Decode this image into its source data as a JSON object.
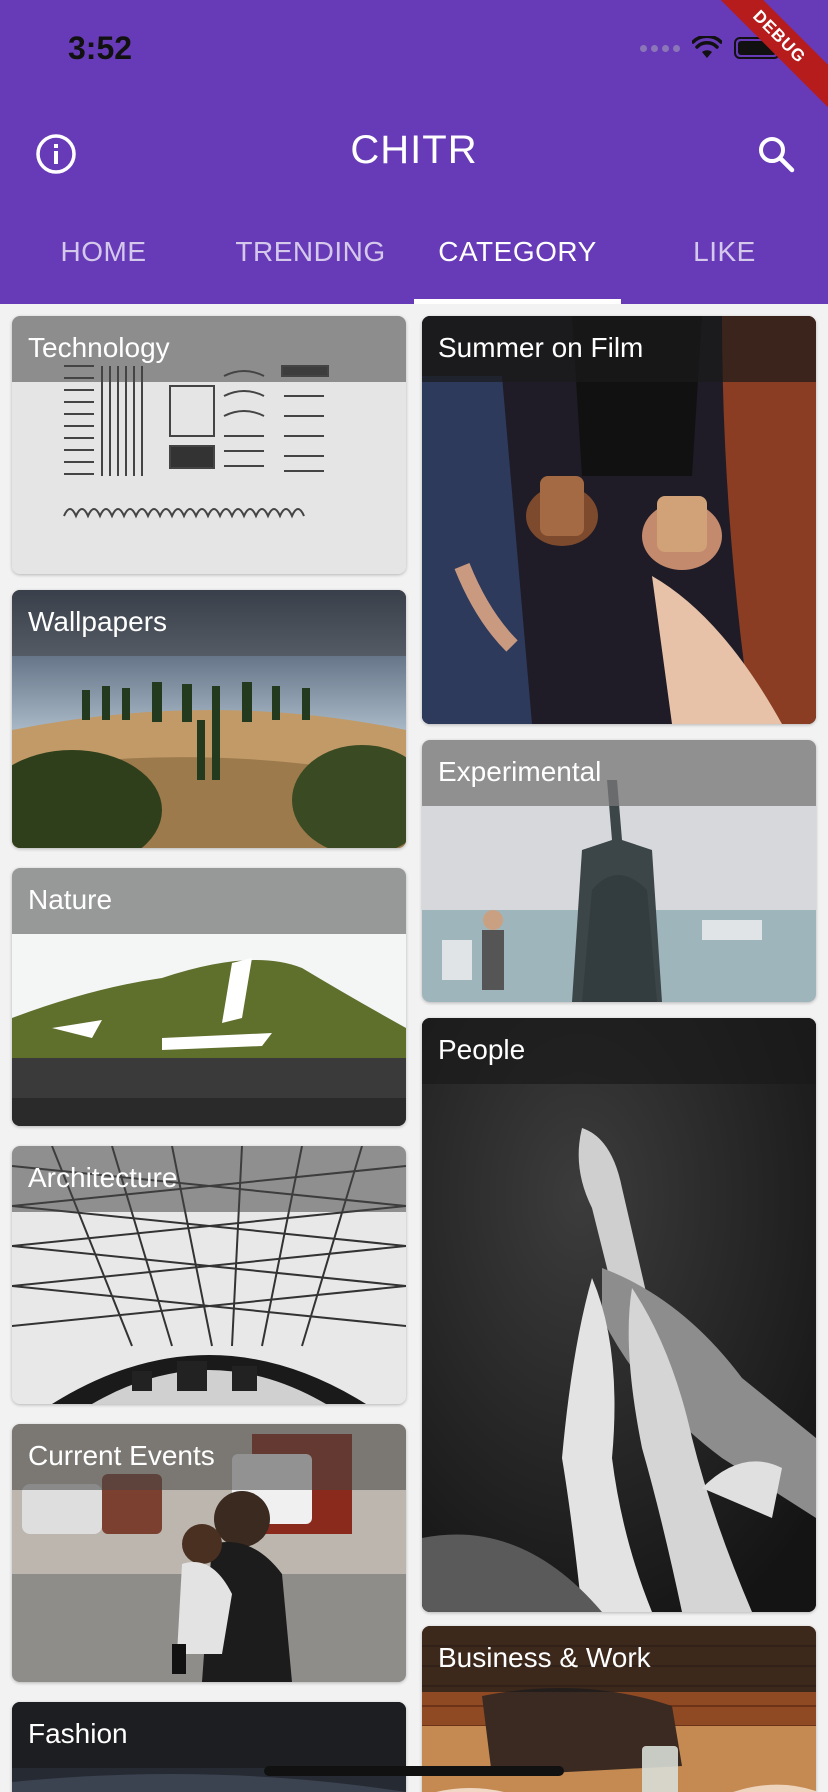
{
  "status": {
    "time": "3:52"
  },
  "debug": {
    "label": "DEBUG"
  },
  "appbar": {
    "title": "CHITR",
    "color": "#673ab7"
  },
  "tabs": [
    {
      "label": "HOME"
    },
    {
      "label": "TRENDING"
    },
    {
      "label": "CATEGORY",
      "active": true
    },
    {
      "label": "LIKE"
    }
  ],
  "categories": {
    "technology": "Technology",
    "summer_on_film": "Summer on Film",
    "wallpapers": "Wallpapers",
    "experimental": "Experimental",
    "nature": "Nature",
    "people": "People",
    "architecture": "Architecture",
    "current_events": "Current Events",
    "business_work": "Business & Work",
    "fashion": "Fashion"
  }
}
